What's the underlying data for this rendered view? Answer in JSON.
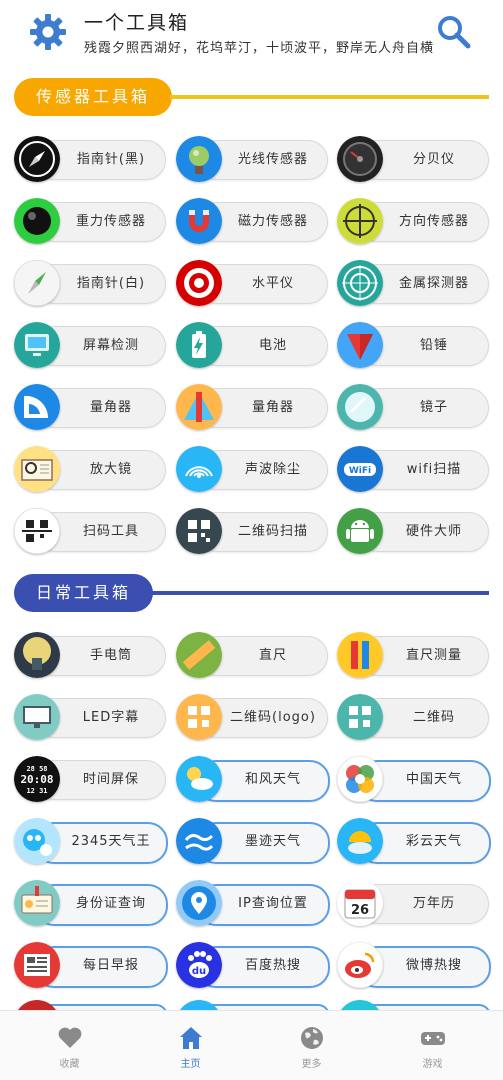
{
  "header": {
    "title": "一个工具箱",
    "subtitle": "残霞夕照西湖好，花坞苹汀，十顷波平，野岸无人舟自横"
  },
  "sections": {
    "sensor": {
      "title": "传感器工具箱",
      "color": "#f7a700"
    },
    "daily": {
      "title": "日常工具箱",
      "color": "#3b4fb0"
    }
  },
  "sensor_tools": [
    {
      "label": "指南针(黑)",
      "icon": "compass-black-icon"
    },
    {
      "label": "光线传感器",
      "icon": "light-sensor-icon"
    },
    {
      "label": "分贝仪",
      "icon": "decibel-meter-icon"
    },
    {
      "label": "重力传感器",
      "icon": "gravity-sensor-icon"
    },
    {
      "label": "磁力传感器",
      "icon": "magnet-icon"
    },
    {
      "label": "方向传感器",
      "icon": "crosshair-icon"
    },
    {
      "label": "指南针(白)",
      "icon": "compass-white-icon"
    },
    {
      "label": "水平仪",
      "icon": "level-target-icon"
    },
    {
      "label": "金属探测器",
      "icon": "radar-icon"
    },
    {
      "label": "屏幕检测",
      "icon": "monitor-icon"
    },
    {
      "label": "电池",
      "icon": "battery-icon"
    },
    {
      "label": "铅锤",
      "icon": "plumb-bob-icon"
    },
    {
      "label": "量角器",
      "icon": "protractor-icon"
    },
    {
      "label": "量角器",
      "icon": "ruler-triangle-icon"
    },
    {
      "label": "镜子",
      "icon": "mirror-icon"
    },
    {
      "label": "放大镜",
      "icon": "magnifier-icon"
    },
    {
      "label": "声波除尘",
      "icon": "sound-wave-icon"
    },
    {
      "label": "wifi扫描",
      "icon": "wifi-icon"
    },
    {
      "label": "扫码工具",
      "icon": "scan-icon"
    },
    {
      "label": "二维码扫描",
      "icon": "qrcode-scan-icon"
    },
    {
      "label": "硬件大师",
      "icon": "android-icon"
    }
  ],
  "daily_tools": [
    {
      "label": "手电筒",
      "icon": "flashlight-icon",
      "blue": false
    },
    {
      "label": "直尺",
      "icon": "ruler-icon",
      "blue": false
    },
    {
      "label": "直尺测量",
      "icon": "ruler-pencil-icon",
      "blue": false
    },
    {
      "label": "LED字幕",
      "icon": "led-screen-icon",
      "blue": false
    },
    {
      "label": "二维码(logo)",
      "icon": "qrcode-logo-icon",
      "blue": false
    },
    {
      "label": "二维码",
      "icon": "qrcode-icon",
      "blue": false
    },
    {
      "label": "时间屏保",
      "icon": "digital-clock-icon",
      "blue": false
    },
    {
      "label": "和风天气",
      "icon": "weather-sun-icon",
      "blue": true
    },
    {
      "label": "中国天气",
      "icon": "china-weather-icon",
      "blue": true
    },
    {
      "label": "2345天气王",
      "icon": "weather-mascot-icon",
      "blue": true
    },
    {
      "label": "墨迹天气",
      "icon": "moji-weather-icon",
      "blue": true
    },
    {
      "label": "彩云天气",
      "icon": "caiyun-weather-icon",
      "blue": true
    },
    {
      "label": "身份证查询",
      "icon": "id-card-icon",
      "blue": true
    },
    {
      "label": "IP查询位置",
      "icon": "location-pin-icon",
      "blue": true
    },
    {
      "label": "万年历",
      "icon": "calendar-icon",
      "blue": false
    },
    {
      "label": "每日早报",
      "icon": "newspaper-icon",
      "blue": true
    },
    {
      "label": "百度热搜",
      "icon": "baidu-icon",
      "blue": true
    },
    {
      "label": "微博热搜",
      "icon": "weibo-icon",
      "blue": true
    }
  ],
  "clock_text": {
    "top": "28 58",
    "main": "20:08",
    "bottom": "12 31"
  },
  "calendar_day": "26",
  "nav": [
    {
      "label": "收藏",
      "icon": "heart-icon"
    },
    {
      "label": "主页",
      "icon": "home-icon"
    },
    {
      "label": "更多",
      "icon": "globe-icon"
    },
    {
      "label": "游戏",
      "icon": "gamepad-icon"
    }
  ],
  "colors": {
    "accent": "#3e7bd3",
    "gear": "#3e7bd3",
    "nav_inactive": "#999999"
  }
}
